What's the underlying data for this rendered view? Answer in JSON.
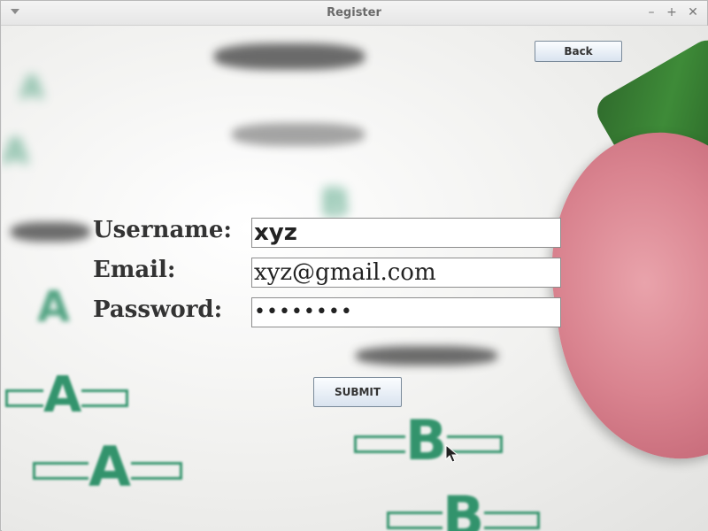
{
  "window": {
    "title": "Register",
    "controls": {
      "minimize": "–",
      "maximize": "+",
      "close": "✕"
    }
  },
  "header": {
    "back_label": "Back"
  },
  "form": {
    "username_label": "Username:",
    "username_value": "xyz",
    "email_label": "Email:",
    "email_value": "xyz@gmail.com",
    "password_label": "Password:",
    "password_masked": "••••••••",
    "submit_label": "SUBMIT"
  },
  "background": {
    "description_icon": "answer-sheet-with-pencil-eraser",
    "accent_green": "#1f8a5f",
    "eraser_pink": "#d9838f"
  }
}
